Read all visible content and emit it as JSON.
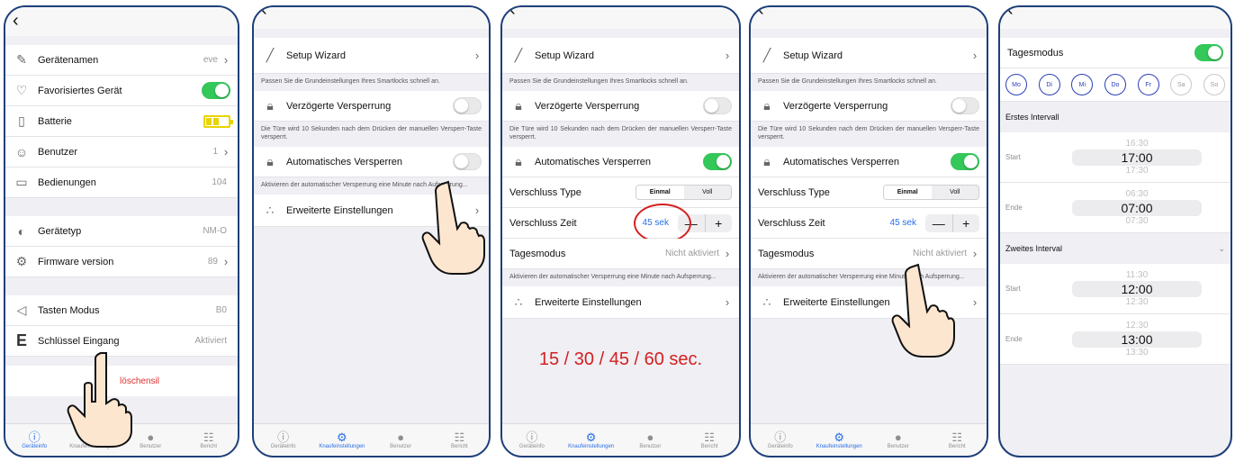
{
  "screen1": {
    "rows_a": [
      {
        "label": "Gerätenamen",
        "value": "eve",
        "icon": "pencil-icon"
      },
      {
        "label": "Favorisiertes Gerät",
        "value": "",
        "icon": "heart-icon"
      },
      {
        "label": "Batterie",
        "value": "",
        "icon": "battery-icon"
      },
      {
        "label": "Benutzer",
        "value": "1",
        "icon": "users-icon"
      },
      {
        "label": "Bedienungen",
        "value": "104",
        "icon": "counter-icon"
      }
    ],
    "rows_b": [
      {
        "label": "Gerätetyp",
        "value": "NM-O",
        "icon": "device-icon"
      },
      {
        "label": "Firmware version",
        "value": "89",
        "icon": "gears-icon"
      }
    ],
    "rows_c": [
      {
        "label": "Tasten Modus",
        "value": "B0",
        "icon": "buttons-icon"
      },
      {
        "label": "Schlüssel Eingang",
        "value": "Aktiviert",
        "icon": "e-icon"
      }
    ],
    "delete_label": "löschensil",
    "favorite_on": true,
    "battery_level": 0.66
  },
  "tabs": [
    "Geräteinfo",
    "Knaufeinstellungen",
    "Benutzer",
    "Bericht"
  ],
  "settings": {
    "wizard": "Setup Wizard",
    "wizard_desc": "Passen Sie die Grundeinstellungen Ihres Smartlocks schnell an.",
    "delayed": "Verzögerte Versperrung",
    "delayed_desc": "Die Türe wird 10 Sekunden nach dem Drücken der manuellen Versperr-Taste versperrt.",
    "auto": "Automatisches Versperren",
    "auto_desc": "Aktivieren der automatischer Versperrung eine Minute nach Aufsperrung...",
    "advanced": "Erweiterte Einstellungen",
    "lock_type": "Verschluss Type",
    "seg_once": "Einmal",
    "seg_full": "Voll",
    "lock_time": "Verschluss Zeit",
    "lock_time_value": "45 sek",
    "minus": "—",
    "plus": "+",
    "day_mode": "Tagesmodus",
    "day_mode_value": "Nicht aktiviert"
  },
  "screen3": {
    "options_text": "15 / 30 / 45 / 60 sec."
  },
  "screen5": {
    "day_mode": "Tagesmodus",
    "day_mode_on": true,
    "days": [
      {
        "label": "Mo",
        "active": true
      },
      {
        "label": "Di",
        "active": true
      },
      {
        "label": "Mi",
        "active": true
      },
      {
        "label": "Do",
        "active": true
      },
      {
        "label": "Fr",
        "active": true
      },
      {
        "label": "Sa",
        "active": false
      },
      {
        "label": "So",
        "active": false
      }
    ],
    "first_interval": "Erstes Intervall",
    "second_interval": "Zweites Interval",
    "start": "Start",
    "end": "Ende",
    "i1_start": [
      "16:30",
      "17:00",
      "17:30"
    ],
    "i1_end": [
      "06:30",
      "07:00",
      "07:30"
    ],
    "i2_start": [
      "11:30",
      "12:00",
      "12:30"
    ],
    "i2_end": [
      "12:30",
      "13:00",
      "13:30"
    ]
  },
  "colors": {
    "frame": "#1e3f7a",
    "toggle_on": "#34c759",
    "accent_blue": "#2a6ee8",
    "red": "#d42020",
    "battery": "#e8d400"
  }
}
